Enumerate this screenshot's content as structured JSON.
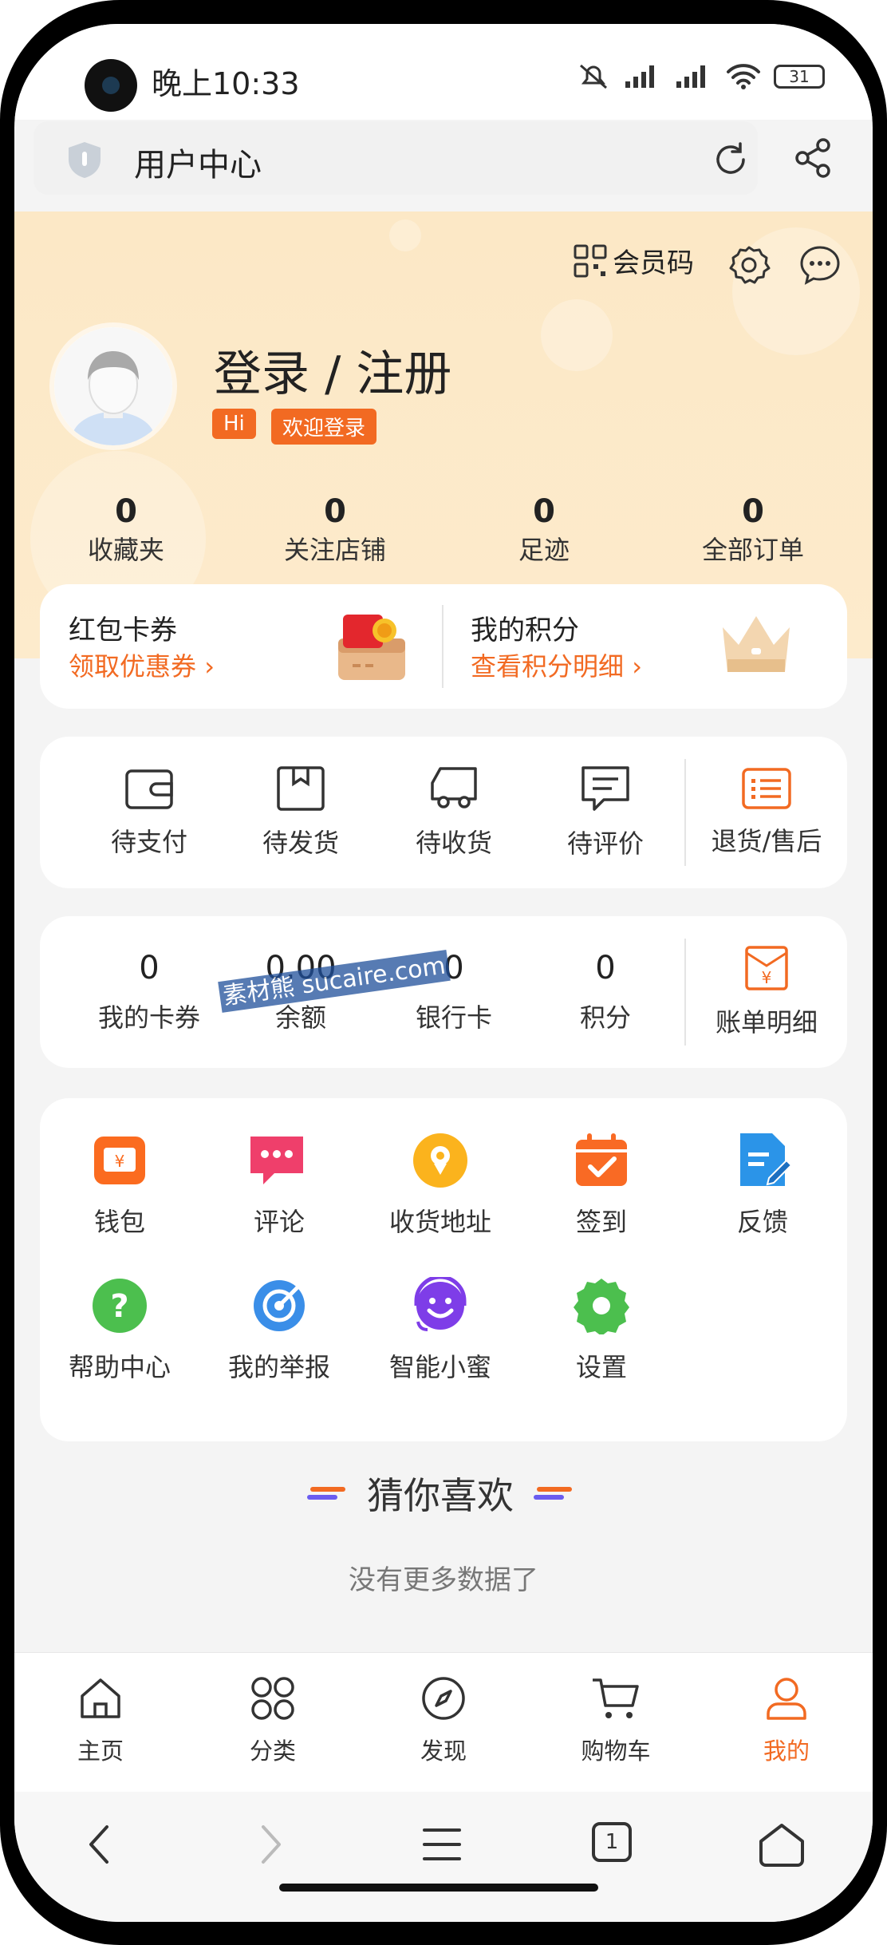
{
  "status_bar": {
    "time": "晚上10:33",
    "battery": "31"
  },
  "address_bar": {
    "title": "用户中心"
  },
  "header": {
    "member_code_label": "会员码",
    "login_title": "登录 / 注册",
    "hi_badge": "Hi",
    "welcome_badge": "欢迎登录",
    "stats": [
      {
        "value": "0",
        "label": "收藏夹"
      },
      {
        "value": "0",
        "label": "关注店铺"
      },
      {
        "value": "0",
        "label": "足迹"
      },
      {
        "value": "0",
        "label": "全部订单"
      }
    ]
  },
  "promo": {
    "left_title": "红包卡券",
    "left_link": "领取优惠券",
    "right_title": "我的积分",
    "right_link": "查看积分明细"
  },
  "orders": {
    "items": [
      {
        "label": "待支付",
        "icon": "wallet-icon"
      },
      {
        "label": "待发货",
        "icon": "box-icon"
      },
      {
        "label": "待收货",
        "icon": "truck-icon"
      },
      {
        "label": "待评价",
        "icon": "comment-icon"
      },
      {
        "label": "退货/售后",
        "icon": "return-list-icon"
      }
    ]
  },
  "assets": {
    "items": [
      {
        "value": "0",
        "label": "我的卡券"
      },
      {
        "value": "0.00",
        "label": "余额"
      },
      {
        "value": "0",
        "label": "银行卡"
      },
      {
        "value": "0",
        "label": "积分"
      }
    ],
    "bill_label": "账单明细",
    "watermark": "素材熊 sucaire.com"
  },
  "tools": {
    "items": [
      {
        "label": "钱包",
        "icon": "wallet-icon",
        "color": "#fb6b1f"
      },
      {
        "label": "评论",
        "icon": "comment-icon",
        "color": "#ef3f6b"
      },
      {
        "label": "收货地址",
        "icon": "location-icon",
        "color": "#fbb31d"
      },
      {
        "label": "签到",
        "icon": "calendar-icon",
        "color": "#f96a24"
      },
      {
        "label": "反馈",
        "icon": "feedback-icon",
        "color": "#2b94e8"
      },
      {
        "label": "帮助中心",
        "icon": "help-icon",
        "color": "#4cbf4e"
      },
      {
        "label": "我的举报",
        "icon": "report-icon",
        "color": "#3a8ee8"
      },
      {
        "label": "智能小蜜",
        "icon": "assistant-icon",
        "color": "#7e3de8"
      },
      {
        "label": "设置",
        "icon": "gear-icon",
        "color": "#4cbf4e"
      }
    ]
  },
  "recommend": {
    "title": "猜你喜欢",
    "empty_text": "没有更多数据了"
  },
  "tabbar": {
    "items": [
      {
        "label": "主页",
        "icon": "home-icon"
      },
      {
        "label": "分类",
        "icon": "category-icon"
      },
      {
        "label": "发现",
        "icon": "compass-icon"
      },
      {
        "label": "购物车",
        "icon": "cart-icon"
      },
      {
        "label": "我的",
        "icon": "user-icon"
      }
    ],
    "active_color": "#f26a22"
  },
  "browser_nav": {
    "tab_count": "1"
  },
  "colors": {
    "accent": "#f26a22",
    "header_bg": "#fce8c6"
  }
}
